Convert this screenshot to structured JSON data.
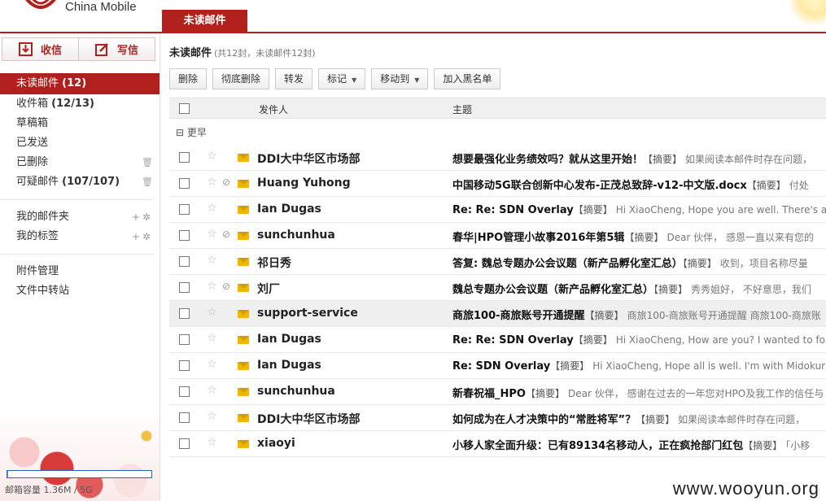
{
  "header": {
    "brand": "China Mobile",
    "active_tab": "未读邮件"
  },
  "sidebar": {
    "receive_label": "收信",
    "compose_label": "写信",
    "folders": [
      {
        "label": "未读邮件",
        "count": "(12)"
      },
      {
        "label": "收件箱",
        "count": "(12/13)"
      },
      {
        "label": "草稿箱",
        "count": ""
      },
      {
        "label": "已发送",
        "count": ""
      },
      {
        "label": "已删除",
        "count": ""
      },
      {
        "label": "可疑邮件",
        "count": "(107/107)"
      }
    ],
    "my_folders": "我的邮件夹",
    "my_tags": "我的标签",
    "attachments": "附件管理",
    "file_transfer": "文件中转站",
    "quota_text": "邮箱容量 1.36M / 5G",
    "quota_fraction": 0.001
  },
  "main": {
    "title": "未读邮件",
    "subtitle": "(共12封，未读邮件12封)",
    "toolbar": {
      "delete": "删除",
      "perm_delete": "彻底删除",
      "forward": "转发",
      "mark": "标记",
      "move_to": "移动到",
      "blacklist": "加入黑名单"
    },
    "columns": {
      "sender": "发件人",
      "subject": "主题"
    },
    "group_label": "更早",
    "summary_tag": "【摘要】",
    "emails": [
      {
        "sender": "DDI大中华区市场部",
        "subject": "想要最强化业务绩效吗？就从这里开始！",
        "preview": "如果阅读本邮件时存在问题，",
        "attachment": false
      },
      {
        "sender": "Huang Yuhong",
        "subject": "中国移动5G联合创新中心发布-正茂总致辞-v12-中文版.docx",
        "preview": "付处",
        "attachment": true
      },
      {
        "sender": "Ian Dugas",
        "subject": "Re: Re: SDN Overlay",
        "preview": "Hi XiaoCheng,   Hope you are well.   There's a",
        "attachment": false
      },
      {
        "sender": "sunchunhua",
        "subject": "春华|HPO管理小故事2016年第5辑",
        "preview": "Dear 伙伴，  感恩一直以来有您的",
        "attachment": true
      },
      {
        "sender": "祁日秀",
        "subject": "答复: 魏总专题办公会议题（新产品孵化室汇总）",
        "preview": "收到，项目名称尽量",
        "attachment": false
      },
      {
        "sender": "刘厂",
        "subject": "魏总专题办公会议题（新产品孵化室汇总）",
        "preview": "秀秀姐好，  不好意思，我们",
        "attachment": true
      },
      {
        "sender": "support-service",
        "subject": "商旅100-商旅账号开通提醒",
        "preview": "商旅100-商旅账号开通提醒 商旅100-商旅账",
        "attachment": false
      },
      {
        "sender": "Ian Dugas",
        "subject": "Re: Re: SDN Overlay",
        "preview": "Hi XiaoCheng, How are you? I wanted to follow",
        "attachment": false
      },
      {
        "sender": "Ian Dugas",
        "subject": "Re: SDN Overlay",
        "preview": "Hi XiaoCheng,   Hope all is well. I'm with Midokura.",
        "attachment": false
      },
      {
        "sender": "sunchunhua",
        "subject": "新春祝福_HPO",
        "preview": "Dear 伙伴，  感谢在过去的一年您对HPO及我工作的信任与",
        "attachment": false
      },
      {
        "sender": "DDI大中华区市场部",
        "subject": "如何成为在人才决策中的“常胜将军”？",
        "preview": "如果阅读本邮件时存在问题，",
        "attachment": false
      },
      {
        "sender": "xiaoyi",
        "subject": "小移人家全面升级：已有89134名移动人，正在疯抢部门红包",
        "preview": "「小移",
        "attachment": false
      }
    ],
    "highlighted_index": 6
  },
  "watermark": "www.wooyun.org",
  "colors": {
    "accent": "#b1201d",
    "envelope": "#f4b400"
  }
}
